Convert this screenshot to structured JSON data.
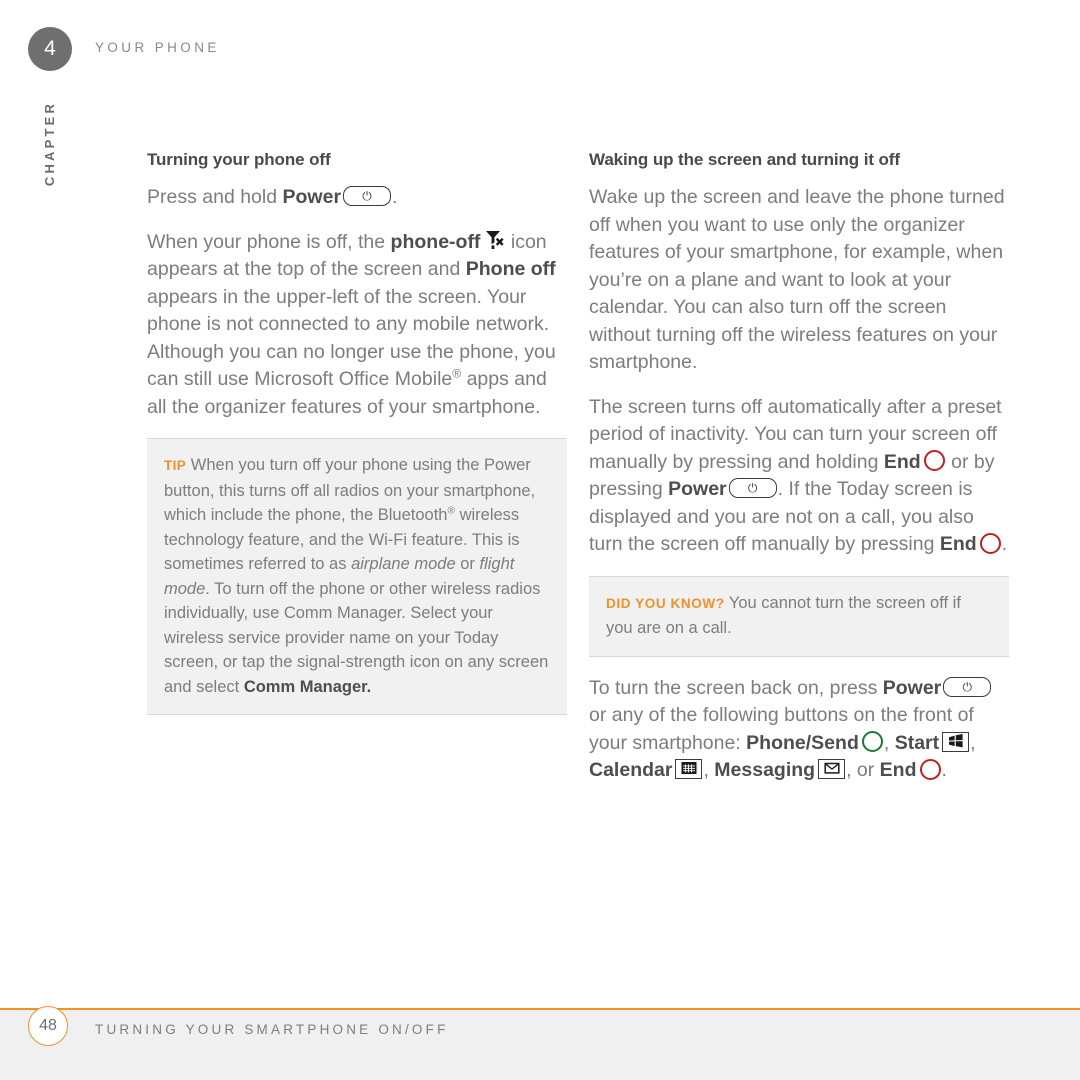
{
  "header": {
    "chapter_number": "4",
    "running_head": "YOUR PHONE",
    "chapter_word": "CHAPTER"
  },
  "left_column": {
    "section_title": "Turning your phone off",
    "para1": {
      "t1": "Press and hold ",
      "b1": "Power",
      "icon1": "power-button-icon",
      "t2": "."
    },
    "para2": {
      "t1": "When your phone is off, the ",
      "b1": "phone-off",
      "icon1": "phone-off-signal-icon",
      "t2": " icon appears at the top of the screen and ",
      "b2": "Phone off",
      "t3": " appears in the upper-left of the screen. Your phone is not connected to any mobile network. Although you can no longer use the phone, you can still use Microsoft Office Mobile",
      "sup1": "®",
      "t4": " apps and all the organizer features of your smartphone."
    },
    "tip": {
      "label": "TIP",
      "t1": " When you turn off your phone using the Power button, this turns off all radios on your smartphone, which include the phone, the Bluetooth",
      "sup1": "®",
      "t2": " wireless technology feature, and the Wi-Fi feature. This is sometimes referred to as ",
      "i1": "airplane mode",
      "t3": " or ",
      "i2": "flight mode",
      "t4": ". To turn off the phone or other wireless radios individually, use Comm Manager. Select your wireless service provider name on your Today screen, or tap the signal-strength icon on any screen and select ",
      "b1": "Comm Manager."
    }
  },
  "right_column": {
    "section_title": "Waking up the screen and turning it off",
    "para1": "Wake up the screen and leave the phone turned off when you want to use only the organizer features of your smartphone, for example, when you’re on a plane and want to look at your calendar. You can also turn off the screen without turning off the wireless features on your smartphone.",
    "para2": {
      "t1": "The screen turns off automatically after a preset period of inactivity. You can turn your screen off manually by pressing and holding ",
      "b1": "End",
      "icon1": "end-button-icon",
      "t2": " or by pressing ",
      "b2": "Power",
      "icon2": "power-button-icon",
      "t3": ". If the Today screen is displayed and you are not on a call, you also turn the screen off manually by pressing ",
      "b3": "End",
      "icon3": "end-button-icon",
      "t4": "."
    },
    "did_you_know": {
      "label": "DID YOU KNOW?",
      "text": " You cannot turn the screen off if you are on a call."
    },
    "para3": {
      "t1": "To turn the screen back on, press ",
      "b1": "Power",
      "icon1": "power-button-icon",
      "t2": " or any of the following buttons on the front of your smartphone: ",
      "b2": "Phone/Send",
      "icon2": "phone-send-button-icon",
      "t3": ", ",
      "b3": "Start",
      "icon3": "start-button-icon",
      "t4": ", ",
      "b4": "Calendar",
      "icon4": "calendar-button-icon",
      "t5": ", ",
      "b5": "Messaging",
      "icon5": "messaging-button-icon",
      "t6": ", or ",
      "b6": "End",
      "icon6": "end-button-icon",
      "t7": "."
    }
  },
  "footer": {
    "page_number": "48",
    "title": "TURNING YOUR SMARTPHONE ON/OFF"
  },
  "colors": {
    "accent_orange": "#f2902a",
    "end_red": "#c0201f",
    "send_green": "#1a7a33",
    "body_gray": "#7d7d7d",
    "bold_gray": "#4e4e4e",
    "callout_bg": "#f1f1f1",
    "chapter_badge_bg": "#6f6f6f"
  }
}
